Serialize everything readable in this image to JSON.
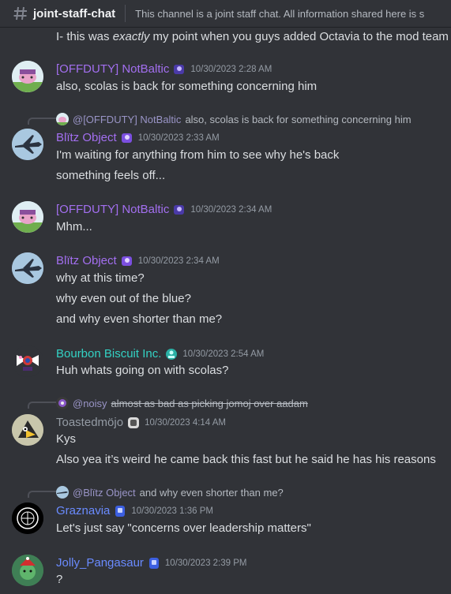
{
  "header": {
    "channel_name": "joint-staff-chat",
    "topic": "This channel is a joint staff chat. All information shared here is s",
    "icon": "hashtag-icon"
  },
  "partial_top": {
    "prefix": "I- this was ",
    "emph": "exactly",
    "suffix": " my point when you guys added Octavia to the mod team"
  },
  "colors": {
    "background": "#313338",
    "purple_name": "#a36ff0",
    "teal_name": "#33d2c4",
    "gray_name": "#949ba4",
    "blue_name": "#6a8bff",
    "timestamp": "#949ba4"
  },
  "messages": [
    {
      "username": "[OFFDUTY] NotBaltic",
      "timestamp": "10/30/2023 2:28 AM",
      "lines": [
        "also, scolas is back for something concerning him"
      ]
    },
    {
      "reply": {
        "name": "@[OFFDUTY] NotBaltic",
        "text": "also, scolas is back for something concerning him"
      },
      "username": "Blïtz Object",
      "timestamp": "10/30/2023 2:33 AM",
      "lines": [
        "I'm waiting for anything from him to see why he's back",
        "something feels off..."
      ]
    },
    {
      "username": "[OFFDUTY] NotBaltic",
      "timestamp": "10/30/2023 2:34 AM",
      "lines": [
        "Mhm..."
      ]
    },
    {
      "username": "Blïtz Object",
      "timestamp": "10/30/2023 2:34 AM",
      "lines": [
        "why at this time?",
        "why even out of the blue?",
        "and why even shorter than me?"
      ]
    },
    {
      "username": "Bourbon Biscuit Inc.",
      "timestamp": "10/30/2023 2:54 AM",
      "lines": [
        "Huh whats going on with scolas?"
      ]
    },
    {
      "reply": {
        "name": "@noisy",
        "text": "almost as bad as picking jomoj over aadam"
      },
      "username": "Toastedmöjo",
      "timestamp": "10/30/2023 4:14 AM",
      "lines": [
        "Kys",
        "Also yea it’s weird he came back this fast but he said he has his reasons"
      ]
    },
    {
      "reply": {
        "name": "@Blïtz Object",
        "text": "and why even shorter than me?"
      },
      "username": "Graznavia",
      "timestamp": "10/30/2023 1:36 PM",
      "lines": [
        "Let's just say \"concerns over leadership matters\""
      ]
    },
    {
      "username": "Jolly_Pangasaur",
      "timestamp": "10/30/2023 2:39 PM",
      "lines": [
        "?"
      ]
    }
  ]
}
